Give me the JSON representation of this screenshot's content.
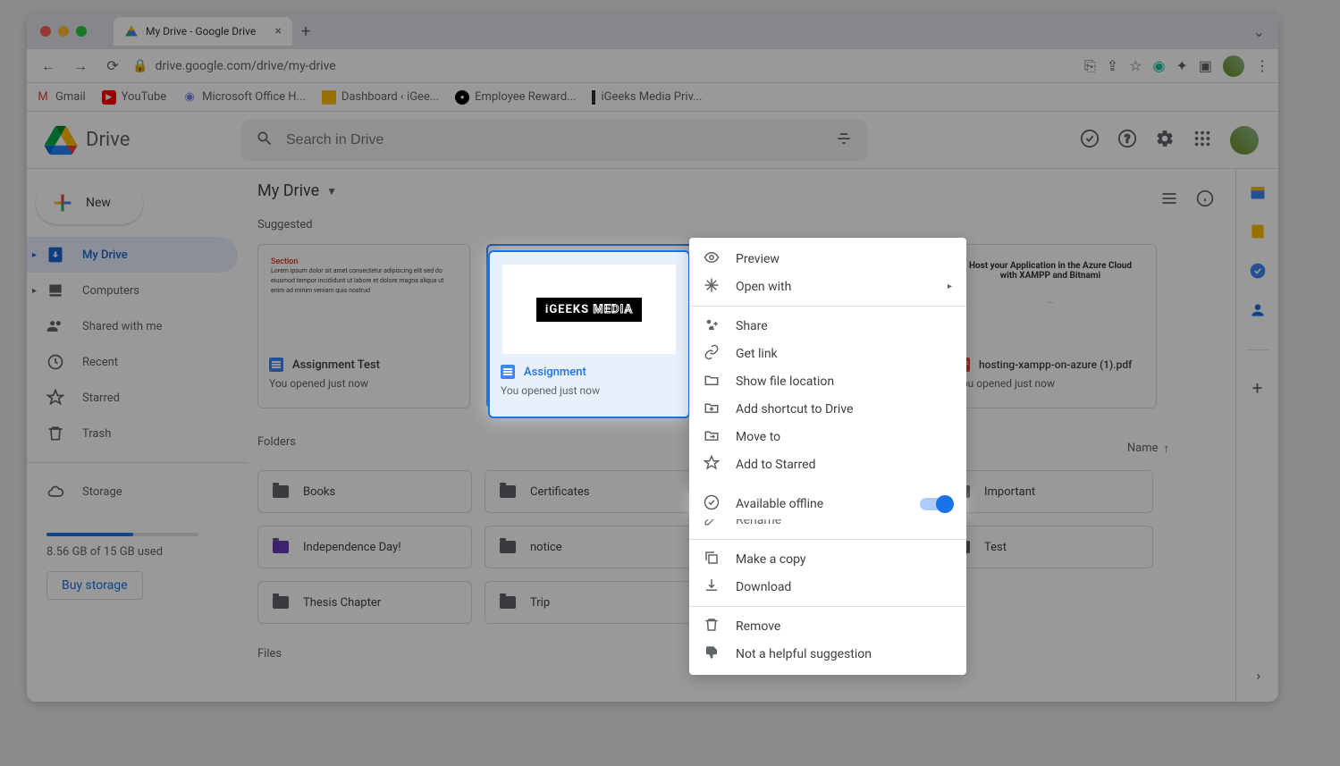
{
  "browser": {
    "tab_title": "My Drive - Google Drive",
    "url": "drive.google.com/drive/my-drive"
  },
  "bookmarks": [
    "Gmail",
    "YouTube",
    "Microsoft Office H...",
    "Dashboard ‹ iGee...",
    "Employee Reward...",
    "iGeeks Media Priv..."
  ],
  "app_title": "Drive",
  "search_placeholder": "Search in Drive",
  "new_button": "New",
  "sidebar": {
    "items": [
      {
        "label": "My Drive",
        "active": true
      },
      {
        "label": "Computers"
      },
      {
        "label": "Shared with me"
      },
      {
        "label": "Recent"
      },
      {
        "label": "Starred"
      },
      {
        "label": "Trash"
      }
    ],
    "storage_label": "Storage",
    "storage_text": "8.56 GB of 15 GB used",
    "buy_storage": "Buy storage"
  },
  "main": {
    "breadcrumb": "My Drive",
    "suggested_label": "Suggested",
    "folders_label": "Folders",
    "files_label": "Files",
    "sort_label": "Name",
    "suggested": [
      {
        "title": "Assignment Test",
        "sub": "You opened just now",
        "type": "doc"
      },
      {
        "title": "Assignment",
        "sub": "You opened just now",
        "type": "doc",
        "selected": true
      },
      {
        "title": "hosting-xampp-on-azure (1).pdf",
        "sub": "You opened just now",
        "type": "pdf",
        "thumb_title": "Host your Application in the Azure Cloud with XAMPP and Bitnami"
      }
    ],
    "folders": [
      "Books",
      "Certificates",
      "Important",
      "Independence Day!",
      "notice",
      "Test",
      "Thesis Chapter",
      "Trip"
    ]
  },
  "context_menu": {
    "items": [
      {
        "label": "Preview",
        "icon": "eye"
      },
      {
        "label": "Open with",
        "icon": "open",
        "arrow": true
      },
      {
        "sep": true
      },
      {
        "label": "Share",
        "icon": "share"
      },
      {
        "label": "Get link",
        "icon": "link"
      },
      {
        "label": "Show file location",
        "icon": "folder"
      },
      {
        "label": "Add shortcut to Drive",
        "icon": "shortcut"
      },
      {
        "label": "Move to",
        "icon": "move"
      },
      {
        "label": "Add to Starred",
        "icon": "star"
      },
      {
        "label": "Available offline",
        "icon": "offline",
        "toggle": true,
        "highlight": true
      },
      {
        "label": "Rename",
        "icon": "pencil"
      },
      {
        "sep": true
      },
      {
        "label": "Make a copy",
        "icon": "copy"
      },
      {
        "label": "Download",
        "icon": "download"
      },
      {
        "sep": true
      },
      {
        "label": "Remove",
        "icon": "trash"
      },
      {
        "label": "Not a helpful suggestion",
        "icon": "thumb-down"
      }
    ]
  },
  "igeeks_logo": "iGEEKS MEDIA"
}
